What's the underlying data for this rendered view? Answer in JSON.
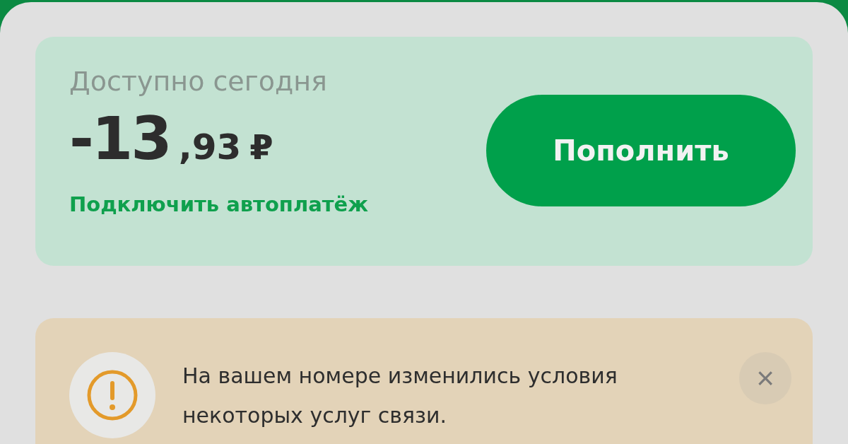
{
  "balance_card": {
    "title": "Доступно сегодня",
    "amount_whole": "-13",
    "amount_fraction": ",93",
    "currency": "₽",
    "autopay_link": "Подключить автоплатёж",
    "top_up_button": "Пополнить"
  },
  "notice": {
    "text": "На вашем номере изменились условия некоторых услуг связи.",
    "close": "×"
  }
}
